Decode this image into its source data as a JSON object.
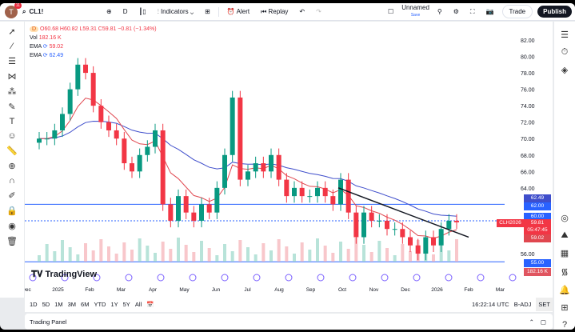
{
  "header": {
    "avatar_letter": "T",
    "notifications": "11",
    "symbol": "CL1!",
    "interval": "D",
    "indicators": "Indicators",
    "alert": "Alert",
    "replay": "Replay",
    "layout_name": "Unnamed",
    "layout_save": "Save",
    "trade": "Trade",
    "publish": "Publish"
  },
  "legend": {
    "interval": "D",
    "ohlc": "O60.68 H60.82 L59.31 C59.81 −0.81 (−1.34%)",
    "vol_label": "Vol",
    "vol_value": "182.16 K",
    "ema1_label": "EMA",
    "ema1_value": "59.02",
    "ema2_label": "EMA",
    "ema2_value": "62.49"
  },
  "price_tags": {
    "ema2": "62.49",
    "line62": "62.00",
    "line60": "60.00",
    "symbol_tag": "CLH2026",
    "last": "59.81",
    "countdown": "05:47:45",
    "ema1": "59.02",
    "line55": "55.00",
    "volume": "182.16 K"
  },
  "colors": {
    "up": "#089981",
    "down": "#f23645",
    "ema_slow": "#3f4ecb",
    "ema_fast": "#e0474f",
    "hline": "#2962ff"
  },
  "logo": "TradingView",
  "timeframes": [
    "1D",
    "5D",
    "1M",
    "3M",
    "6M",
    "YTD",
    "1Y",
    "5Y",
    "All"
  ],
  "footer": {
    "time": "16:22:14 UTC",
    "badj": "B-ADJ",
    "set": "SET",
    "trading_panel": "Trading Panel"
  },
  "chart_data": {
    "type": "candlestick",
    "y_ticks": [
      "82.00",
      "80.00",
      "78.00",
      "76.00",
      "74.00",
      "72.00",
      "70.00",
      "68.00",
      "66.00",
      "64.00",
      "56.00"
    ],
    "x_ticks": [
      "Dec",
      "2025",
      "Feb",
      "Mar",
      "Apr",
      "May",
      "Jun",
      "Jul",
      "Aug",
      "Sep",
      "Oct",
      "Nov",
      "Dec",
      "2026",
      "Feb",
      "Mar"
    ],
    "ylim": [
      54,
      83
    ],
    "weekly_closes": [
      70,
      70,
      71,
      73,
      76,
      79,
      78,
      74,
      72,
      71,
      70,
      67,
      66,
      68,
      69,
      71,
      62,
      60,
      63,
      61,
      60,
      62,
      61,
      64,
      68,
      75,
      65,
      66,
      67,
      66,
      68,
      65,
      63,
      64,
      63,
      63,
      64,
      63,
      62,
      65,
      61,
      58,
      61,
      60,
      60,
      59,
      59,
      58,
      57,
      56,
      58,
      57,
      59,
      60,
      59.81
    ],
    "horizontal_lines": [
      62.0,
      60.0,
      55.0
    ],
    "trendline": {
      "from": {
        "date": "Oct 2025",
        "price": 64
      },
      "to": {
        "date": "Feb 2026",
        "price": 58
      }
    }
  }
}
